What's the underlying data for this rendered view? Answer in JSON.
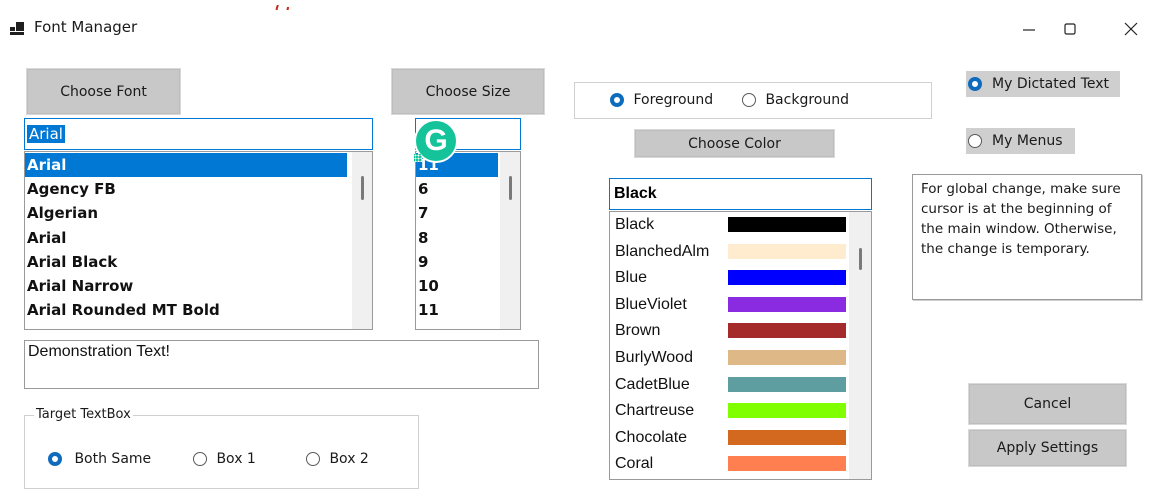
{
  "window": {
    "title": "Font Manager"
  },
  "font": {
    "choose_label": "Choose Font",
    "input_value": "Arial",
    "list": [
      "Arial",
      "Agency FB",
      "Algerian",
      "Arial",
      "Arial Black",
      "Arial Narrow",
      "Arial Rounded MT Bold"
    ],
    "selected_index": 0
  },
  "size": {
    "choose_label": "Choose Size",
    "input_value": "",
    "list": [
      "11",
      "6",
      "7",
      "8",
      "9",
      "10",
      "11"
    ],
    "selected_index": 0
  },
  "demo": {
    "text": "Demonstration Text!"
  },
  "target": {
    "legend": "Target TextBox",
    "options": [
      "Both Same",
      "Box 1",
      "Box 2"
    ],
    "selected_index": 0
  },
  "ground": {
    "options": [
      "Foreground",
      "Background"
    ],
    "selected_index": 0
  },
  "color": {
    "choose_label": "Choose Color",
    "input_value": "Black",
    "list": [
      {
        "name": "Black",
        "swatch": "#000000"
      },
      {
        "name": "BlanchedAlm",
        "swatch": "#FFEBCD"
      },
      {
        "name": "Blue",
        "swatch": "#0000FF"
      },
      {
        "name": "BlueViolet",
        "swatch": "#8A2BE2"
      },
      {
        "name": "Brown",
        "swatch": "#A52A2A"
      },
      {
        "name": "BurlyWood",
        "swatch": "#DEB887"
      },
      {
        "name": "CadetBlue",
        "swatch": "#5F9EA0"
      },
      {
        "name": "Chartreuse",
        "swatch": "#7FFF00"
      },
      {
        "name": "Chocolate",
        "swatch": "#D2691E"
      },
      {
        "name": "Coral",
        "swatch": "#FF7F50"
      }
    ]
  },
  "mode": {
    "options": [
      "My Dictated Text",
      "My Menus"
    ],
    "selected_index": 0
  },
  "info": {
    "text": "For global change, make sure cursor is at the beginning of the main window. Otherwise, the change is temporary."
  },
  "actions": {
    "cancel_label": "Cancel",
    "apply_label": "Apply Settings"
  },
  "grammarly": {
    "letter": "G",
    "color": "#15c39a"
  },
  "accent": "#0078d4"
}
